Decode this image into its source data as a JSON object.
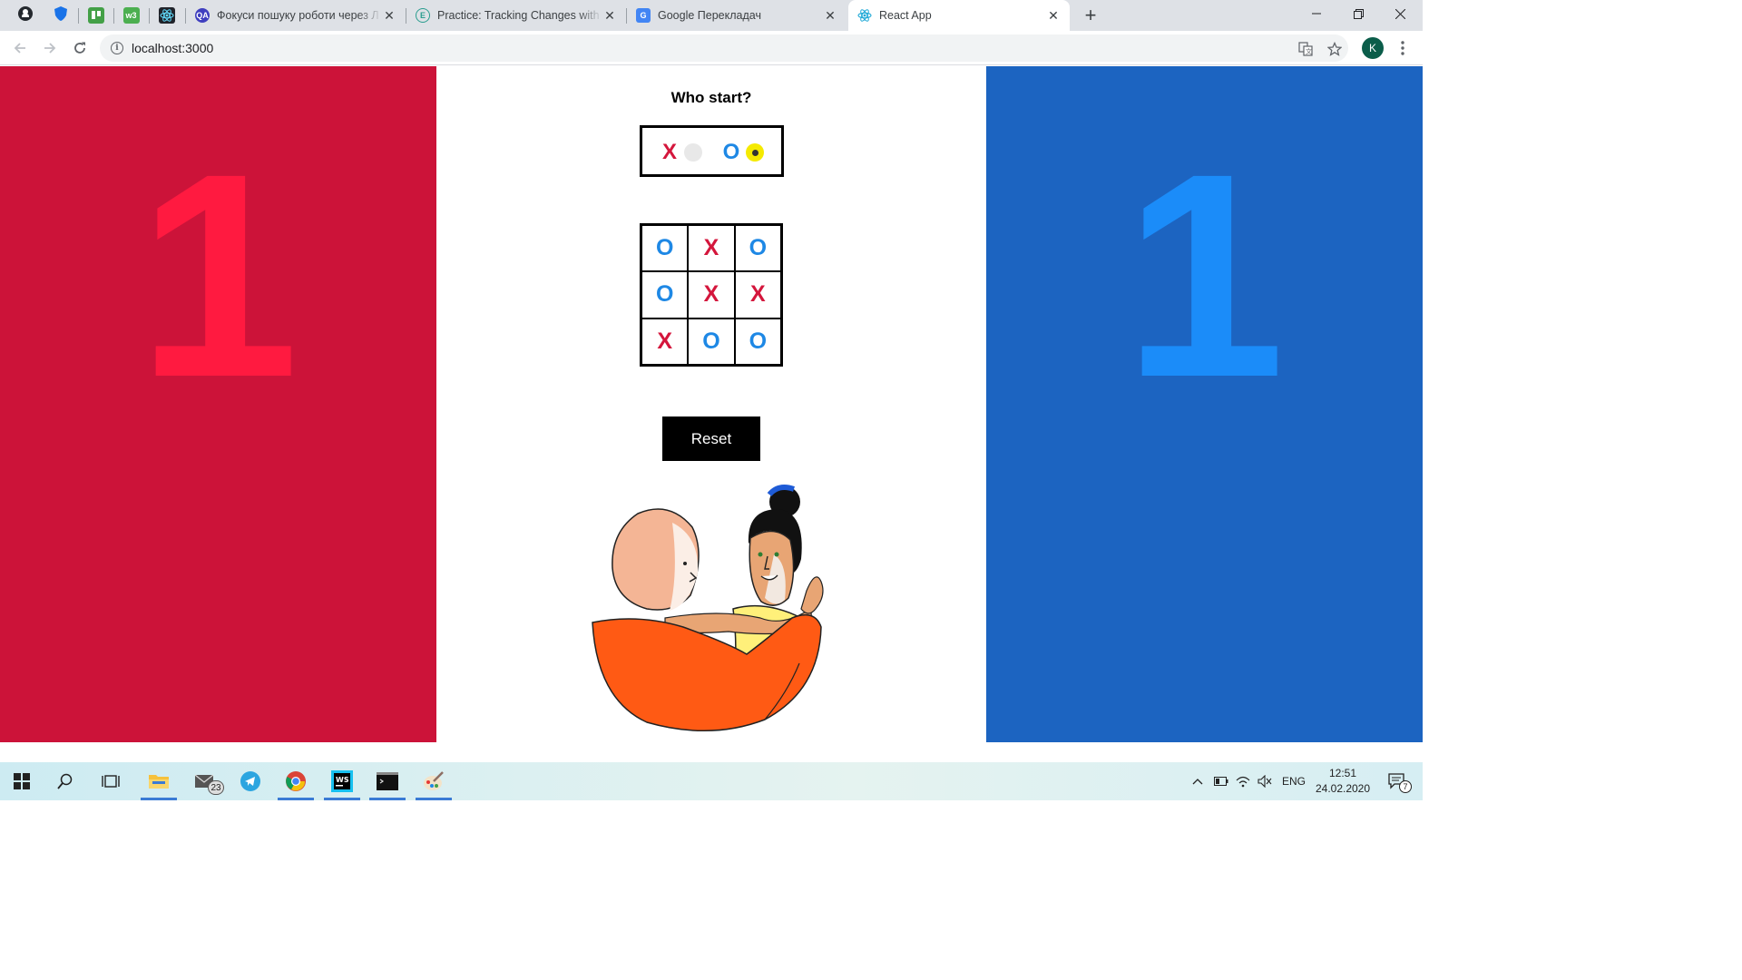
{
  "browser": {
    "pinned_tabs": [
      {
        "name": "github-icon"
      },
      {
        "name": "shield-icon"
      },
      {
        "name": "trello-icon"
      },
      {
        "name": "w3-icon"
      },
      {
        "name": "react-icon"
      }
    ],
    "tabs": [
      {
        "title": "Фокуси пошуку роботи через Л",
        "favicon": "QA"
      },
      {
        "title": "Practice: Tracking Changes with C",
        "favicon": "E"
      },
      {
        "title": "Google Перекладач",
        "favicon": "G"
      },
      {
        "title": "React App",
        "favicon": "react",
        "active": true
      }
    ],
    "url": "localhost:3000",
    "profile_initial": "K",
    "close_glyph": "✕",
    "new_tab_glyph": "+"
  },
  "game": {
    "score_x": "1",
    "score_o": "1",
    "who_start_title": "Who start?",
    "starter_options": [
      {
        "label": "X",
        "selected": false
      },
      {
        "label": "O",
        "selected": true
      }
    ],
    "board": [
      "O",
      "X",
      "O",
      "O",
      "X",
      "X",
      "X",
      "O",
      "O"
    ],
    "reset_label": "Reset",
    "colors": {
      "x_panel": "#cc1339",
      "o_panel": "#1c64c1",
      "x_mark": "#d4163c",
      "o_mark": "#1e88e5",
      "selected_radio": "#f5ea00"
    }
  },
  "taskbar": {
    "mail_badge": "23",
    "language": "ENG",
    "time": "12:51",
    "date": "24.02.2020",
    "notification_count": "7"
  }
}
